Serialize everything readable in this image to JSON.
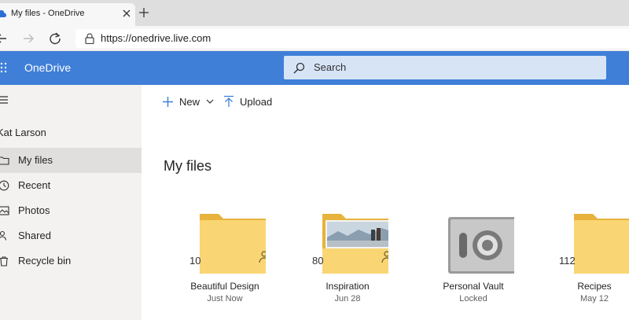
{
  "browser": {
    "tab_title": "My files - OneDrive",
    "url": "https://onedrive.live.com"
  },
  "header": {
    "brand": "OneDrive",
    "search_placeholder": "Search",
    "brand_color": "#3f7fd8"
  },
  "sidebar": {
    "user": "Kat Larson",
    "items": [
      {
        "label": "My files",
        "icon": "folder-icon",
        "active": true
      },
      {
        "label": "Recent",
        "icon": "clock-icon"
      },
      {
        "label": "Photos",
        "icon": "image-icon"
      },
      {
        "label": "Shared",
        "icon": "people-icon"
      },
      {
        "label": "Recycle bin",
        "icon": "trash-icon"
      }
    ]
  },
  "commands": {
    "new_label": "New",
    "upload_label": "Upload"
  },
  "main": {
    "title": "My files",
    "items": [
      {
        "name": "Beautiful Design",
        "sub": "Just Now",
        "count": "10",
        "type": "shared-folder"
      },
      {
        "name": "Inspiration",
        "sub": "Jun 28",
        "count": "80",
        "type": "shared-folder-with-photo"
      },
      {
        "name": "Personal Vault",
        "sub": "Locked",
        "type": "vault"
      },
      {
        "name": "Recipes",
        "sub": "May 12",
        "count": "112",
        "type": "folder"
      }
    ]
  }
}
